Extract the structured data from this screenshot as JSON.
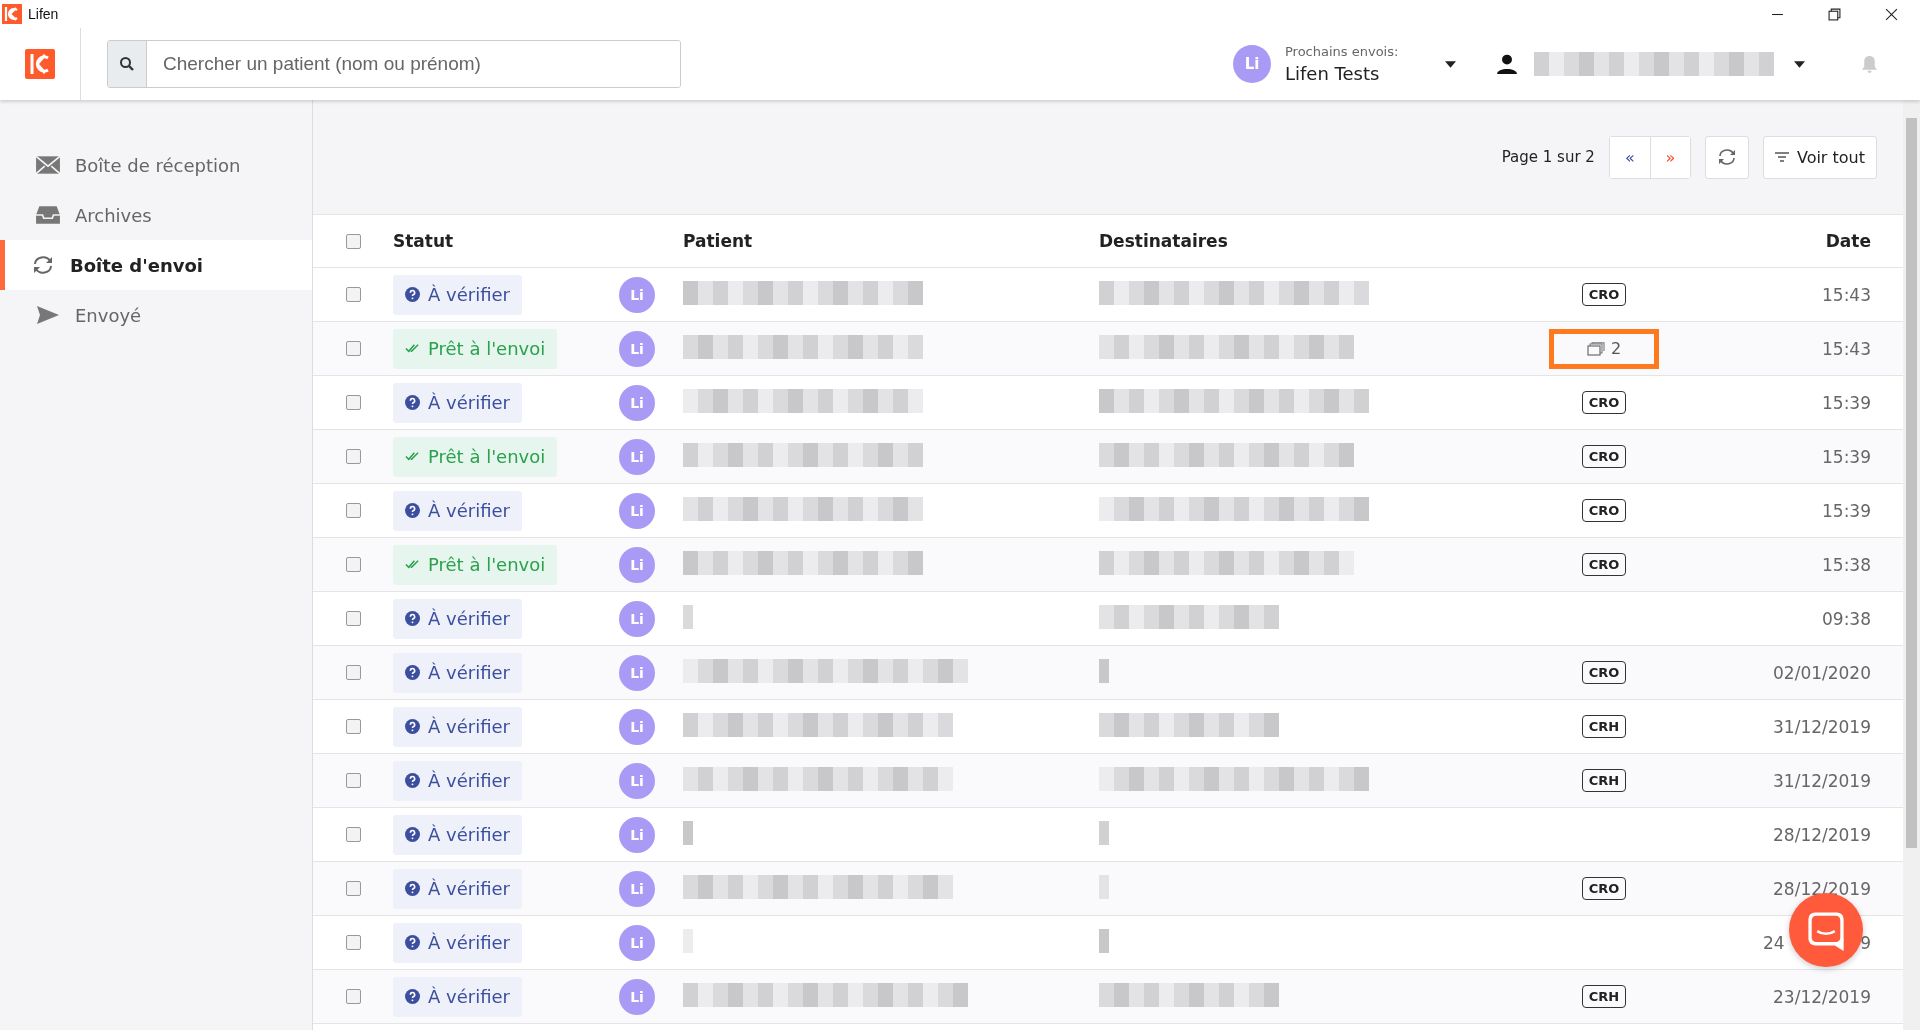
{
  "window": {
    "title": "Lifen"
  },
  "search": {
    "placeholder": "Chercher un patient (nom ou prénom)"
  },
  "next_sending": {
    "avatar": "Li",
    "label": "Prochains envois:",
    "value": "Lifen Tests"
  },
  "sidebar": {
    "items": [
      {
        "label": "Boîte de réception",
        "kind": "mail",
        "selected": false
      },
      {
        "label": "Archives",
        "kind": "archive",
        "selected": false
      },
      {
        "label": "Boîte d'envoi",
        "kind": "sync",
        "selected": true
      },
      {
        "label": "Envoyé",
        "kind": "send",
        "selected": false
      }
    ]
  },
  "toolbar": {
    "page_info": "Page 1 sur 2",
    "prev": "«",
    "next": "»",
    "filter": "Voir tout"
  },
  "table": {
    "select_all_checked": false,
    "columns": [
      "Statut",
      "Patient",
      "Destinataires",
      "Date"
    ],
    "rows": [
      {
        "checked": false,
        "status": {
          "kind": "verify",
          "label": "À vérifier"
        },
        "avatar": "Li",
        "doc": {
          "kind": "tag",
          "label": "CRO"
        },
        "date": "15:43",
        "highlighted": false
      },
      {
        "checked": false,
        "status": {
          "kind": "ready",
          "label": "Prêt à l'envoi"
        },
        "avatar": "Li",
        "doc": {
          "kind": "count",
          "label": "2"
        },
        "date": "15:43",
        "highlighted": true
      },
      {
        "checked": false,
        "status": {
          "kind": "verify",
          "label": "À vérifier"
        },
        "avatar": "Li",
        "doc": {
          "kind": "tag",
          "label": "CRO"
        },
        "date": "15:39",
        "highlighted": false
      },
      {
        "checked": false,
        "status": {
          "kind": "ready",
          "label": "Prêt à l'envoi"
        },
        "avatar": "Li",
        "doc": {
          "kind": "tag",
          "label": "CRO"
        },
        "date": "15:39",
        "highlighted": false
      },
      {
        "checked": false,
        "status": {
          "kind": "verify",
          "label": "À vérifier"
        },
        "avatar": "Li",
        "doc": {
          "kind": "tag",
          "label": "CRO"
        },
        "date": "15:39",
        "highlighted": false
      },
      {
        "checked": false,
        "status": {
          "kind": "ready",
          "label": "Prêt à l'envoi"
        },
        "avatar": "Li",
        "doc": {
          "kind": "tag",
          "label": "CRO"
        },
        "date": "15:38",
        "highlighted": false
      },
      {
        "checked": false,
        "status": {
          "kind": "verify",
          "label": "À vérifier"
        },
        "avatar": "Li",
        "date": "09:38",
        "highlighted": false
      },
      {
        "checked": false,
        "status": {
          "kind": "verify",
          "label": "À vérifier"
        },
        "avatar": "Li",
        "doc": {
          "kind": "tag",
          "label": "CRO"
        },
        "date": "02/01/2020",
        "highlighted": false
      },
      {
        "checked": false,
        "status": {
          "kind": "verify",
          "label": "À vérifier"
        },
        "avatar": "Li",
        "doc": {
          "kind": "tag",
          "label": "CRH"
        },
        "date": "31/12/2019",
        "highlighted": false
      },
      {
        "checked": false,
        "status": {
          "kind": "verify",
          "label": "À vérifier"
        },
        "avatar": "Li",
        "doc": {
          "kind": "tag",
          "label": "CRH"
        },
        "date": "31/12/2019",
        "highlighted": false
      },
      {
        "checked": false,
        "status": {
          "kind": "verify",
          "label": "À vérifier"
        },
        "avatar": "Li",
        "date": "28/12/2019",
        "highlighted": false
      },
      {
        "checked": false,
        "status": {
          "kind": "verify",
          "label": "À vérifier"
        },
        "avatar": "Li",
        "doc": {
          "kind": "tag",
          "label": "CRO"
        },
        "date": "28/12/2019",
        "highlighted": false
      },
      {
        "checked": false,
        "status": {
          "kind": "verify",
          "label": "À vérifier"
        },
        "avatar": "Li",
        "date": "24",
        "date_end": "9",
        "highlighted": false
      },
      {
        "checked": false,
        "status": {
          "kind": "verify",
          "label": "À vérifier"
        },
        "avatar": "Li",
        "doc": {
          "kind": "tag",
          "label": "CRH"
        },
        "date": "23/12/2019",
        "highlighted": false
      }
    ]
  }
}
